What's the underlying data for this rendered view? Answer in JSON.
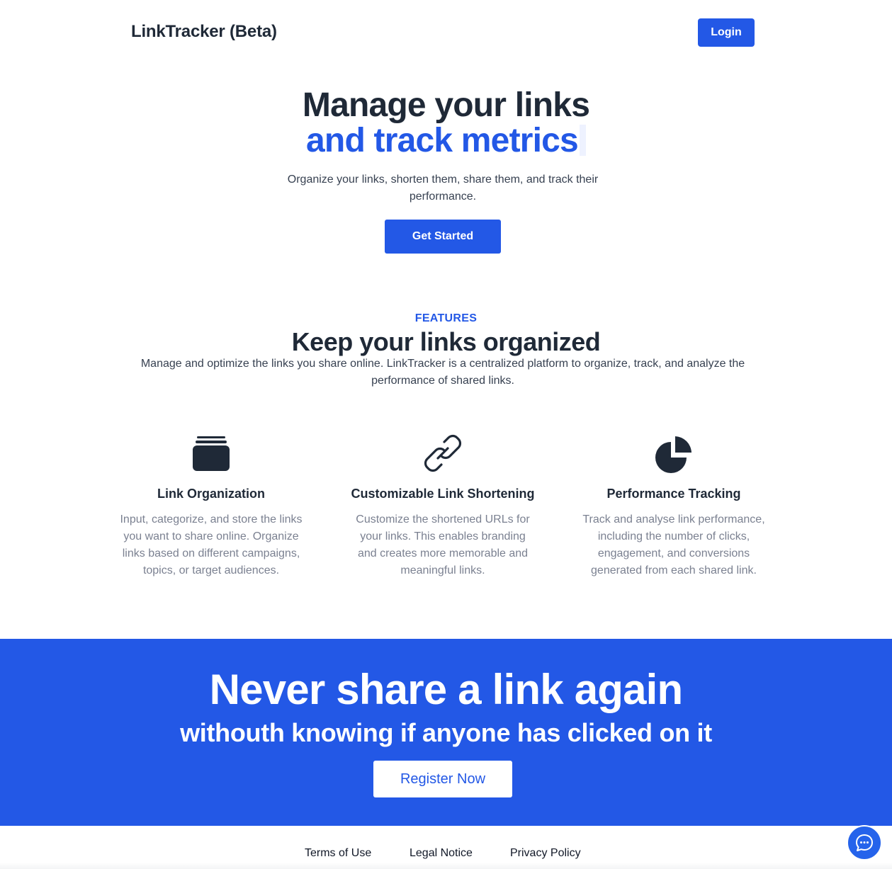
{
  "header": {
    "brand": "LinkTracker (Beta)",
    "login_label": "Login"
  },
  "hero": {
    "title_line1": "Manage your links",
    "title_line2": "and track metrics",
    "subtitle": "Organize your links, shorten them, share them, and track their performance.",
    "cta_label": "Get Started"
  },
  "features": {
    "eyebrow": "FEATURES",
    "title": "Keep your links organized",
    "description": "Manage and optimize the links you share online. LinkTracker is a centralized platform to organize, track, and analyze the performance of shared links.",
    "items": [
      {
        "icon": "stack-icon",
        "title": "Link Organization",
        "description": "Input, categorize, and store the links you want to share online. Organize links based on different campaigns, topics, or target audiences."
      },
      {
        "icon": "link-icon",
        "title": "Customizable Link Shortening",
        "description": "Customize the shortened URLs for your links. This enables branding and creates more memorable and meaningful links."
      },
      {
        "icon": "pie-chart-icon",
        "title": "Performance Tracking",
        "description": "Track and analyse link performance, including the number of clicks, engagement, and conversions generated from each shared link."
      }
    ]
  },
  "banner": {
    "title": "Never share a link again",
    "subtitle": "withouth knowing if anyone has clicked on it",
    "register_label": "Register Now"
  },
  "footer": {
    "links": [
      "Terms of Use",
      "Legal Notice",
      "Privacy Policy"
    ]
  },
  "chat": {
    "icon": "chat-bubble-icon"
  },
  "colors": {
    "accent": "#2358e6",
    "text_dark": "#1f2937",
    "text_muted": "#7b8191"
  }
}
